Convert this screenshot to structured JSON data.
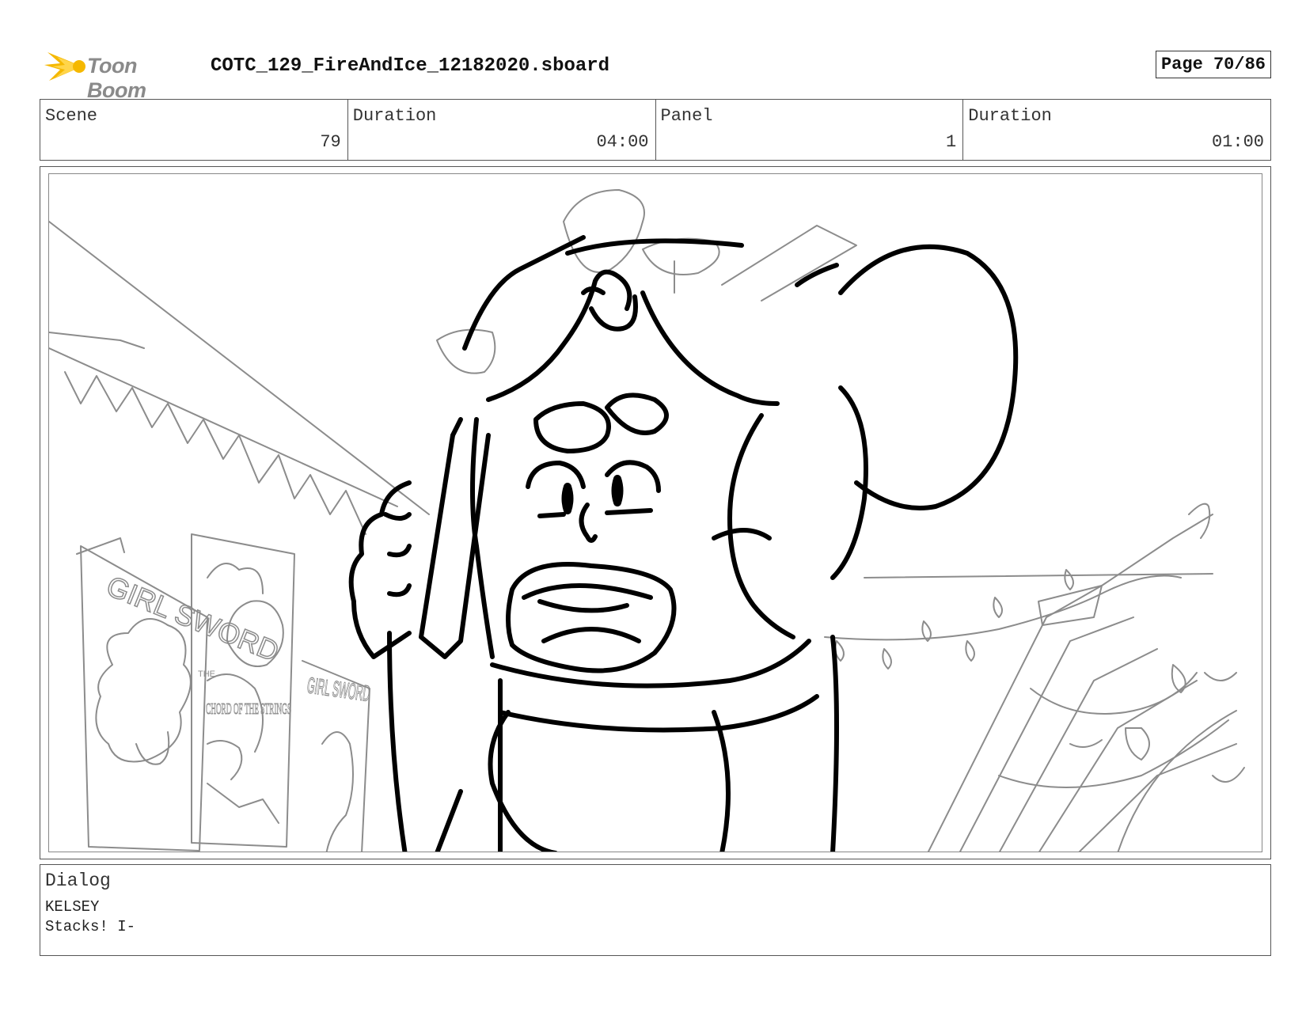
{
  "header": {
    "logo_text": "Toon Boom",
    "filename": "COTC_129_FireAndIce_12182020.sboard",
    "page": "Page 70/86"
  },
  "info": {
    "scene_label": "Scene",
    "scene_value": "79",
    "scene_duration_label": "Duration",
    "scene_duration_value": "04:00",
    "panel_label": "Panel",
    "panel_value": "1",
    "panel_duration_label": "Duration",
    "panel_duration_value": "01:00"
  },
  "panel_image": {
    "poster_left": "GIRL SWORD",
    "poster_middle_small": "THE",
    "poster_middle": "CHORD OF THE STRINGS",
    "poster_right": "GIRL SWORD"
  },
  "dialog": {
    "label": "Dialog",
    "speaker": "KELSEY",
    "line": "Stacks! I-"
  },
  "colors": {
    "logo_yellow": "#f5b800",
    "logo_text": "#8a8a8a",
    "sketch_light": "#8c8c8c",
    "ink": "#000000"
  }
}
